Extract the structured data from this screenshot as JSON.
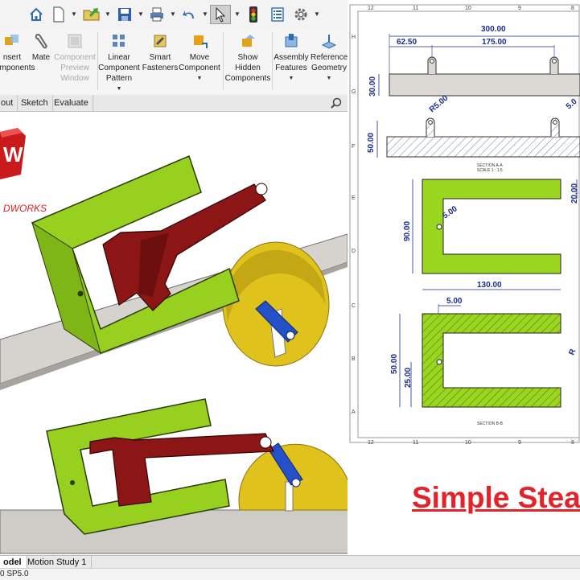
{
  "quick_access": {
    "icons": [
      "home-icon",
      "new-document-icon",
      "open-icon",
      "save-icon",
      "print-icon",
      "undo-icon",
      "select-icon",
      "rebuild-icon",
      "file-properties-icon",
      "options-icon"
    ]
  },
  "ribbon": {
    "buttons": [
      {
        "name": "insert-components",
        "label": "Insert\nComponents",
        "partial": "nsert\nomponents",
        "enabled": true
      },
      {
        "name": "mate",
        "label": "Mate",
        "enabled": true
      },
      {
        "name": "component-preview-window",
        "label": "Component\nPreview\nWindow",
        "enabled": false
      },
      {
        "name": "linear-component-pattern",
        "label": "Linear\nComponent\nPattern",
        "enabled": true
      },
      {
        "name": "smart-fasteners",
        "label": "Smart\nFasteners",
        "enabled": true
      },
      {
        "name": "move-component",
        "label": "Move\nComponent",
        "enabled": true
      },
      {
        "name": "show-hidden-components",
        "label": "Show\nHidden\nComponents",
        "enabled": true
      },
      {
        "name": "assembly-features",
        "label": "Assembly\nFeatures",
        "enabled": true
      },
      {
        "name": "reference-geometry",
        "label": "Reference\nGeometry",
        "enabled": true
      }
    ]
  },
  "command_tabs": [
    "out",
    "Sketch",
    "Evaluate"
  ],
  "logo": {
    "text": "DWORKS",
    "badge_letter": "W"
  },
  "drawing": {
    "border_numbers_top": [
      "12",
      "11",
      "10",
      "9",
      "8"
    ],
    "border_numbers_bottom": [
      "12",
      "11",
      "10",
      "9",
      "8"
    ],
    "border_letters": [
      "H",
      "G",
      "F",
      "E",
      "D",
      "C",
      "B",
      "A"
    ],
    "dims": {
      "total_length": "300.00",
      "offset": "62.50",
      "spacing": "175.00",
      "height_top": "30.00",
      "radius_left": "R5.00",
      "radius_right": "5.0",
      "height_section": "50.00",
      "section_aa": "SECTION A-A",
      "scale_aa": "SCALE 1 : 1.5",
      "hole_dia": "5.00",
      "c_height": "90.00",
      "c_arm": "20.00",
      "c_width": "130.00",
      "hole_offset": "5.00",
      "sect_height": "50.00",
      "sect_half": "25.00",
      "section_bb": "SECTION B-B",
      "partial_r": "R"
    }
  },
  "overlay_title": "Simple Stea",
  "bottom_tabs": [
    "odel",
    "Motion Study 1"
  ],
  "status": {
    "text": "0 SP5.0"
  },
  "colors": {
    "green": "#95d21f",
    "red": "#8a1717",
    "yellow": "#e2c419",
    "blue": "#1f4fc4",
    "grey": "#cfcbc6",
    "dim_blue": "#1b2d8f",
    "title_red": "#e3222a"
  }
}
